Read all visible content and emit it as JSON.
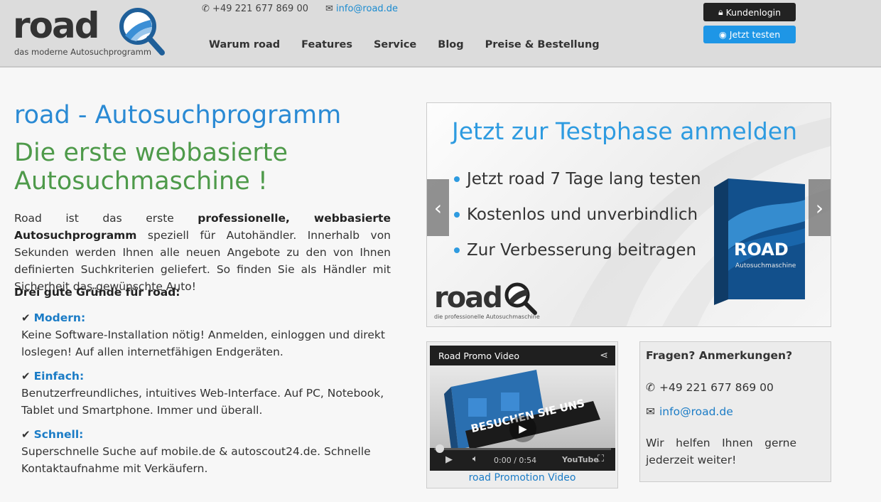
{
  "header": {
    "logo_word": "road",
    "logo_tagline": "das moderne Autosuchprogramm",
    "phone": "+49 221 677 869 00",
    "email": "info@road.de",
    "nav": [
      "Warum road",
      "Features",
      "Service",
      "Blog",
      "Preise & Bestellung"
    ],
    "login_label": "Kundenlogin",
    "test_label": "Jetzt testen"
  },
  "main": {
    "title": "road - Autosuchprogramm",
    "subtitle": "Die erste webbasierte Autosuchmaschine !",
    "intro_pre": "Road ist das erste ",
    "intro_bold": "professionelle, webbasierte Autosuchprogramm",
    "intro_post": " speziell für Autohändler. Innerhalb von Sekunden werden Ihnen alle neuen Angebote zu den von Ihnen definierten Suchkriterien geliefert. So finden Sie als Händler mit Sicherheit das gewünschte Auto!",
    "reasons_title": "Drei gute Gründe für road:",
    "reasons": [
      {
        "title": "Modern:",
        "text": "Keine Software-Installation nötig! Anmelden, einloggen und direkt loslegen! Auf allen internetfähigen Endgeräten."
      },
      {
        "title": "Einfach:",
        "text": "Benutzerfreundliches, intuitives Web-Interface. Auf PC, Notebook, Tablet und Smartphone. Immer und überall."
      },
      {
        "title": "Schnell:",
        "text": "Superschnelle Suche auf mobile.de & autoscout24.de. Schnelle Kontaktaufnahme mit Verkäufern."
      }
    ]
  },
  "carousel": {
    "title": "Jetzt zur Testphase anmelden",
    "bullets": [
      "Jetzt road 7 Tage lang testen",
      "Kostenlos und unverbindlich",
      "Zur Verbesserung beitragen"
    ],
    "logo_word": "road",
    "logo_tagline": "die professionelle Autosuchmaschine",
    "box_label": "ROAD",
    "box_sublabel": "Autosuchmaschine",
    "prev": "‹",
    "next": "›"
  },
  "video": {
    "title": "Road Promo Video",
    "overlay_text": "BESUCHEN SIE UNS",
    "time": "0:00 / 0:54",
    "youtube": "YouTube",
    "caption": "road Promotion Video"
  },
  "contact": {
    "title": "Fragen? Anmerkungen?",
    "phone": "+49 221 677 869 00",
    "email": "info@road.de",
    "text": "Wir helfen Ihnen gerne jederzeit weiter!"
  },
  "colors": {
    "accent_blue": "#2a8ad4",
    "accent_green": "#4e9a4a",
    "button_dark": "#222222",
    "button_blue": "#1e96e6"
  }
}
